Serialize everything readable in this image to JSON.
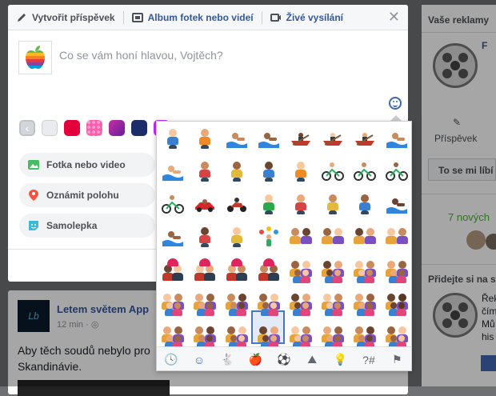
{
  "composer": {
    "tabs": [
      {
        "label": "Vytvořit příspěvek",
        "icon": "pencil-icon"
      },
      {
        "label": "Album fotek nebo videí",
        "icon": "album-icon"
      },
      {
        "label": "Živé vysílání",
        "icon": "video-camera-icon"
      }
    ],
    "placeholder": "Co se vám honí hlavou, Vojtěch?",
    "actions": [
      {
        "label": "Fotka nebo video",
        "icon": "photo-icon",
        "color": "#45bd62"
      },
      {
        "label": "Oznámit polohu",
        "icon": "location-pin-icon",
        "color": "#f5533d"
      },
      {
        "label": "Samolepka",
        "icon": "sticker-icon",
        "color": "#3cb9d6"
      }
    ],
    "swatch_colors": [
      "#ffffff",
      "#e4003a",
      "#ff5dac",
      "#9b2fcf",
      "#1c2c6b",
      "#b933ff",
      "#5f8cff",
      "#26a0ff"
    ]
  },
  "right": {
    "title": "Vaše reklamy",
    "post_label": "Příspěvek",
    "like_label": "To se mi líbí",
    "new_label": "7 nových",
    "join_label": "Přidejte si na s",
    "small_labels": [
      "Řek",
      "čím",
      "Mů",
      "his"
    ]
  },
  "post": {
    "avatar_text": "Lb",
    "name": "Letem světem App",
    "time": "12 min ·",
    "text": "Aby těch soudů nebylo pro Skandinávie."
  },
  "picker": {
    "categories": [
      {
        "icon": "clock-icon",
        "glyph": "🕓"
      },
      {
        "icon": "smiley-icon",
        "glyph": "☺"
      },
      {
        "icon": "rabbit-icon",
        "glyph": "🐇"
      },
      {
        "icon": "apple-icon",
        "glyph": "🍎"
      },
      {
        "icon": "soccer-ball-icon",
        "glyph": "⚽"
      },
      {
        "icon": "mountain-icon",
        "glyph": "⛰"
      },
      {
        "icon": "lightbulb-icon",
        "glyph": "💡"
      },
      {
        "icon": "symbols-icon",
        "glyph": "?#"
      },
      {
        "icon": "flag-icon",
        "glyph": "⚑"
      }
    ],
    "rows": [
      [
        "golfer",
        "golfer",
        "surfer",
        "surfer",
        "rower",
        "rower",
        "rower",
        "swimmer"
      ],
      [
        "swimmer",
        "bouncer",
        "bouncer",
        "lifter",
        "lifter",
        "cyclist",
        "cyclist",
        "cyclist"
      ],
      [
        "mtb",
        "car",
        "motorcycle",
        "cartwheel",
        "cartwheel",
        "wrestlers",
        "wrestlers",
        "waterpolo"
      ],
      [
        "waterpolo",
        "handball",
        "handball",
        "juggler",
        "couple",
        "couple",
        "couple",
        "couple"
      ],
      [
        "kiss",
        "kiss",
        "kiss",
        "kiss",
        "family",
        "family",
        "family",
        "family"
      ],
      [
        "family",
        "family-hl",
        "family-hl",
        "family-hl",
        "family-hl",
        "family-hl",
        "family-hl",
        "family-dark"
      ],
      [
        "family",
        "family",
        "family",
        "family-sel",
        "family",
        "family",
        "family",
        "family"
      ]
    ]
  }
}
